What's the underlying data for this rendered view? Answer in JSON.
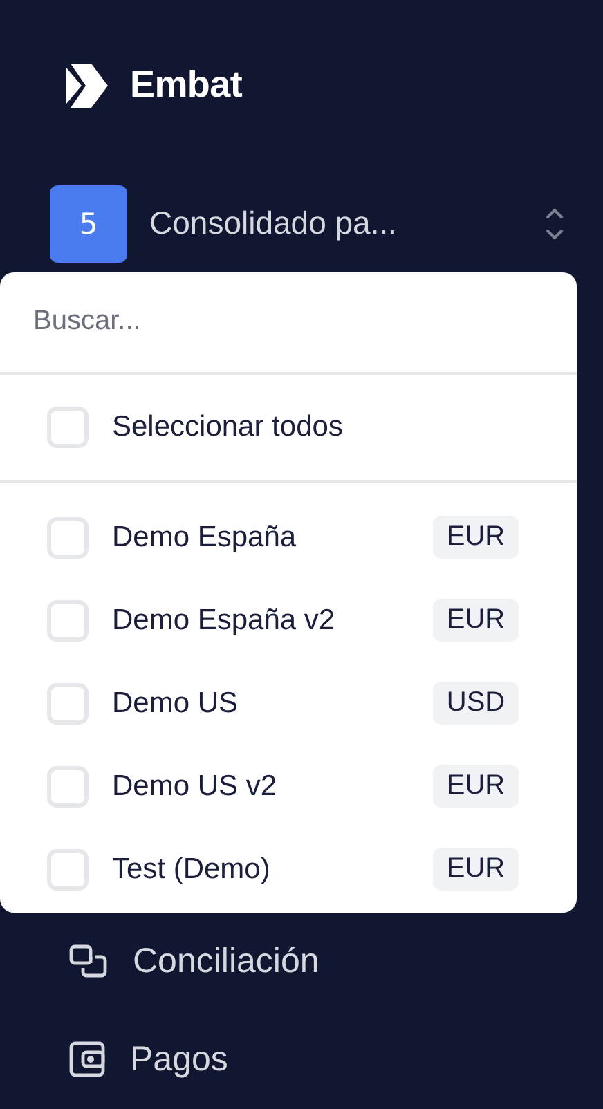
{
  "brand": {
    "name": "Embat"
  },
  "selector": {
    "count": "5",
    "label": "Consolidado pa..."
  },
  "dropdown": {
    "search": {
      "placeholder": "Buscar..."
    },
    "select_all": {
      "label": "Seleccionar todos",
      "checked": false
    },
    "items": [
      {
        "label": "Demo España",
        "currency": "EUR",
        "checked": false
      },
      {
        "label": "Demo España v2",
        "currency": "EUR",
        "checked": false
      },
      {
        "label": "Demo US",
        "currency": "USD",
        "checked": false
      },
      {
        "label": "Demo US v2",
        "currency": "EUR",
        "checked": false
      },
      {
        "label": "Test (Demo)",
        "currency": "EUR",
        "checked": false
      }
    ]
  },
  "nav": [
    {
      "kind": "reconcile",
      "label": "Conciliación"
    },
    {
      "kind": "wallet",
      "label": "Pagos"
    }
  ]
}
